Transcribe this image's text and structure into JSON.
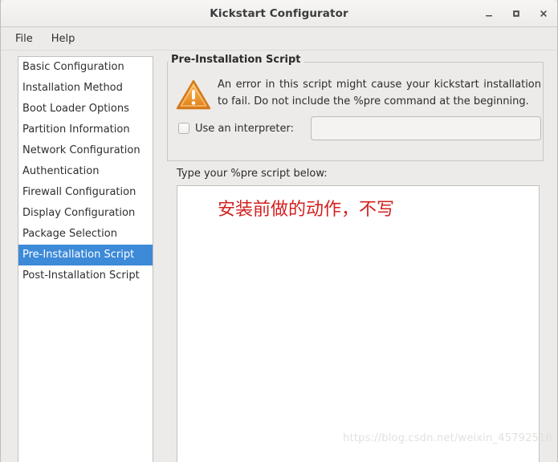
{
  "window": {
    "title": "Kickstart Configurator",
    "controls": {
      "minimize": "minimize-button",
      "maximize": "maximize-button",
      "close": "close-button"
    }
  },
  "menubar": {
    "items": [
      {
        "label": "File"
      },
      {
        "label": "Help"
      }
    ]
  },
  "sidebar": {
    "items": [
      {
        "label": "Basic Configuration",
        "selected": false
      },
      {
        "label": "Installation Method",
        "selected": false
      },
      {
        "label": "Boot Loader Options",
        "selected": false
      },
      {
        "label": "Partition Information",
        "selected": false
      },
      {
        "label": "Network Configuration",
        "selected": false
      },
      {
        "label": "Authentication",
        "selected": false
      },
      {
        "label": "Firewall Configuration",
        "selected": false
      },
      {
        "label": "Display Configuration",
        "selected": false
      },
      {
        "label": "Package Selection",
        "selected": false
      },
      {
        "label": "Pre-Installation Script",
        "selected": true
      },
      {
        "label": "Post-Installation Script",
        "selected": false
      }
    ]
  },
  "main": {
    "group_title": "Pre-Installation Script",
    "warning": {
      "icon": "warning-triangle-icon",
      "text": "An error in this script might cause your kickstart installation to fail. Do not include the %pre command at the beginning."
    },
    "interpreter": {
      "checkbox_checked": false,
      "label": "Use an interpreter:",
      "value": "",
      "placeholder": ""
    },
    "script": {
      "label": "Type your %pre script below:",
      "content": "安装前做的动作，不写",
      "text_color": "#d42020"
    }
  },
  "watermark": {
    "text": "https://blog.csdn.net/weixin_45792518"
  },
  "colors": {
    "selection": "#3c8ad8",
    "window_bg": "#edebe9",
    "field_bg": "#ffffff",
    "warning_orange": "#f0a030"
  }
}
